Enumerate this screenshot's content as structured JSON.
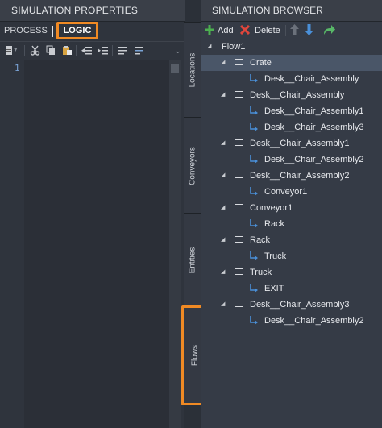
{
  "left_panel": {
    "title": "SIMULATION PROPERTIES",
    "tabs": [
      {
        "label": "PROCESS"
      },
      {
        "label": "LOGIC"
      }
    ],
    "editor": {
      "line_numbers": [
        "1"
      ]
    }
  },
  "vertical_tabs": [
    {
      "label": "Locations"
    },
    {
      "label": "Conveyors"
    },
    {
      "label": "Entities"
    },
    {
      "label": "Flows"
    }
  ],
  "right_panel": {
    "title": "SIMULATION BROWSER",
    "toolbar": {
      "add_label": "Add",
      "delete_label": "Delete"
    },
    "tree": [
      {
        "label": "Flow1",
        "level": 0,
        "type": "root"
      },
      {
        "label": "Crate",
        "level": 1,
        "type": "node",
        "selected": true
      },
      {
        "label": "Desk__Chair_Assembly",
        "level": 2,
        "type": "link"
      },
      {
        "label": "Desk__Chair_Assembly",
        "level": 1,
        "type": "node"
      },
      {
        "label": "Desk__Chair_Assembly1",
        "level": 2,
        "type": "link"
      },
      {
        "label": "Desk__Chair_Assembly3",
        "level": 2,
        "type": "link"
      },
      {
        "label": "Desk__Chair_Assembly1",
        "level": 1,
        "type": "node"
      },
      {
        "label": "Desk__Chair_Assembly2",
        "level": 2,
        "type": "link"
      },
      {
        "label": "Desk__Chair_Assembly2",
        "level": 1,
        "type": "node"
      },
      {
        "label": "Conveyor1",
        "level": 2,
        "type": "link"
      },
      {
        "label": "Conveyor1",
        "level": 1,
        "type": "node"
      },
      {
        "label": "Rack",
        "level": 2,
        "type": "link"
      },
      {
        "label": "Rack",
        "level": 1,
        "type": "node"
      },
      {
        "label": "Truck",
        "level": 2,
        "type": "link"
      },
      {
        "label": "Truck",
        "level": 1,
        "type": "node"
      },
      {
        "label": "EXIT",
        "level": 2,
        "type": "link"
      },
      {
        "label": "Desk__Chair_Assembly3",
        "level": 1,
        "type": "node"
      },
      {
        "label": "Desk__Chair_Assembly2",
        "level": 2,
        "type": "link"
      }
    ]
  },
  "colors": {
    "highlight": "#f08a24",
    "selection": "#4a5668",
    "add_icon": "#4caf50",
    "delete_icon": "#e0463c",
    "arrow_icon": "#4a90d9"
  }
}
